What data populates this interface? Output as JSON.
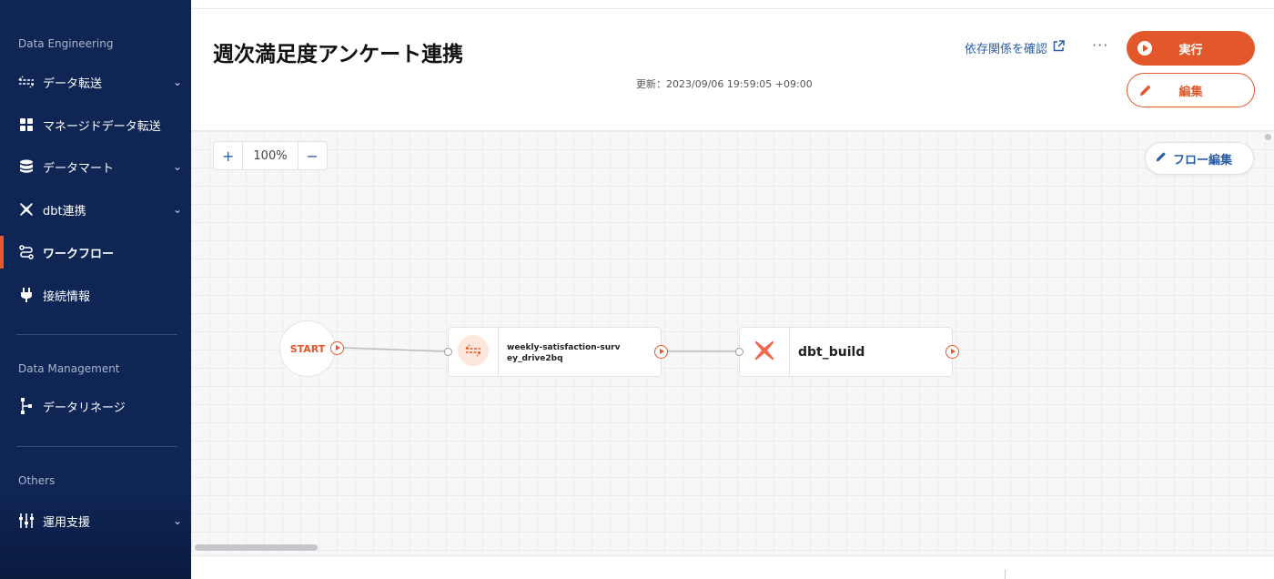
{
  "sidebar": {
    "sections": [
      {
        "title": "Data Engineering"
      },
      {
        "title": "Data Management"
      },
      {
        "title": "Others"
      }
    ],
    "items": [
      {
        "label": "データ転送",
        "icon": "transfer-icon",
        "has_chevron": true
      },
      {
        "label": "マネージドデータ転送",
        "icon": "grid-icon",
        "has_chevron": false
      },
      {
        "label": "データマート",
        "icon": "database-icon",
        "has_chevron": true
      },
      {
        "label": "dbt連携",
        "icon": "dbt-icon",
        "has_chevron": true
      },
      {
        "label": "ワークフロー",
        "icon": "workflow-icon",
        "has_chevron": false,
        "active": true
      },
      {
        "label": "接続情報",
        "icon": "plug-icon",
        "has_chevron": false
      },
      {
        "label": "データリネージ",
        "icon": "lineage-icon",
        "has_chevron": false
      },
      {
        "label": "運用支援",
        "icon": "sliders-icon",
        "has_chevron": true
      }
    ],
    "chevron": "⌄"
  },
  "header": {
    "title": "週次満足度アンケート連携",
    "updated": "更新：2023/09/06 19:59:05 +09:00",
    "dependency_link": "依存関係を確認",
    "more": "···",
    "run_label": "実行",
    "edit_label": "編集"
  },
  "canvas": {
    "zoom_in": "+",
    "zoom_level": "100%",
    "zoom_out": "−",
    "flow_edit_label": "フロー編集",
    "start_label": "START",
    "nodes": [
      {
        "label": "weekly-satisfaction-survey_drive2bq",
        "icon": "transfer-icon"
      },
      {
        "label": "dbt_build",
        "icon": "dbt-icon"
      }
    ]
  },
  "colors": {
    "sidebar_bg": "#0f2554",
    "accent": "#e2582a",
    "link": "#2a5da8"
  }
}
